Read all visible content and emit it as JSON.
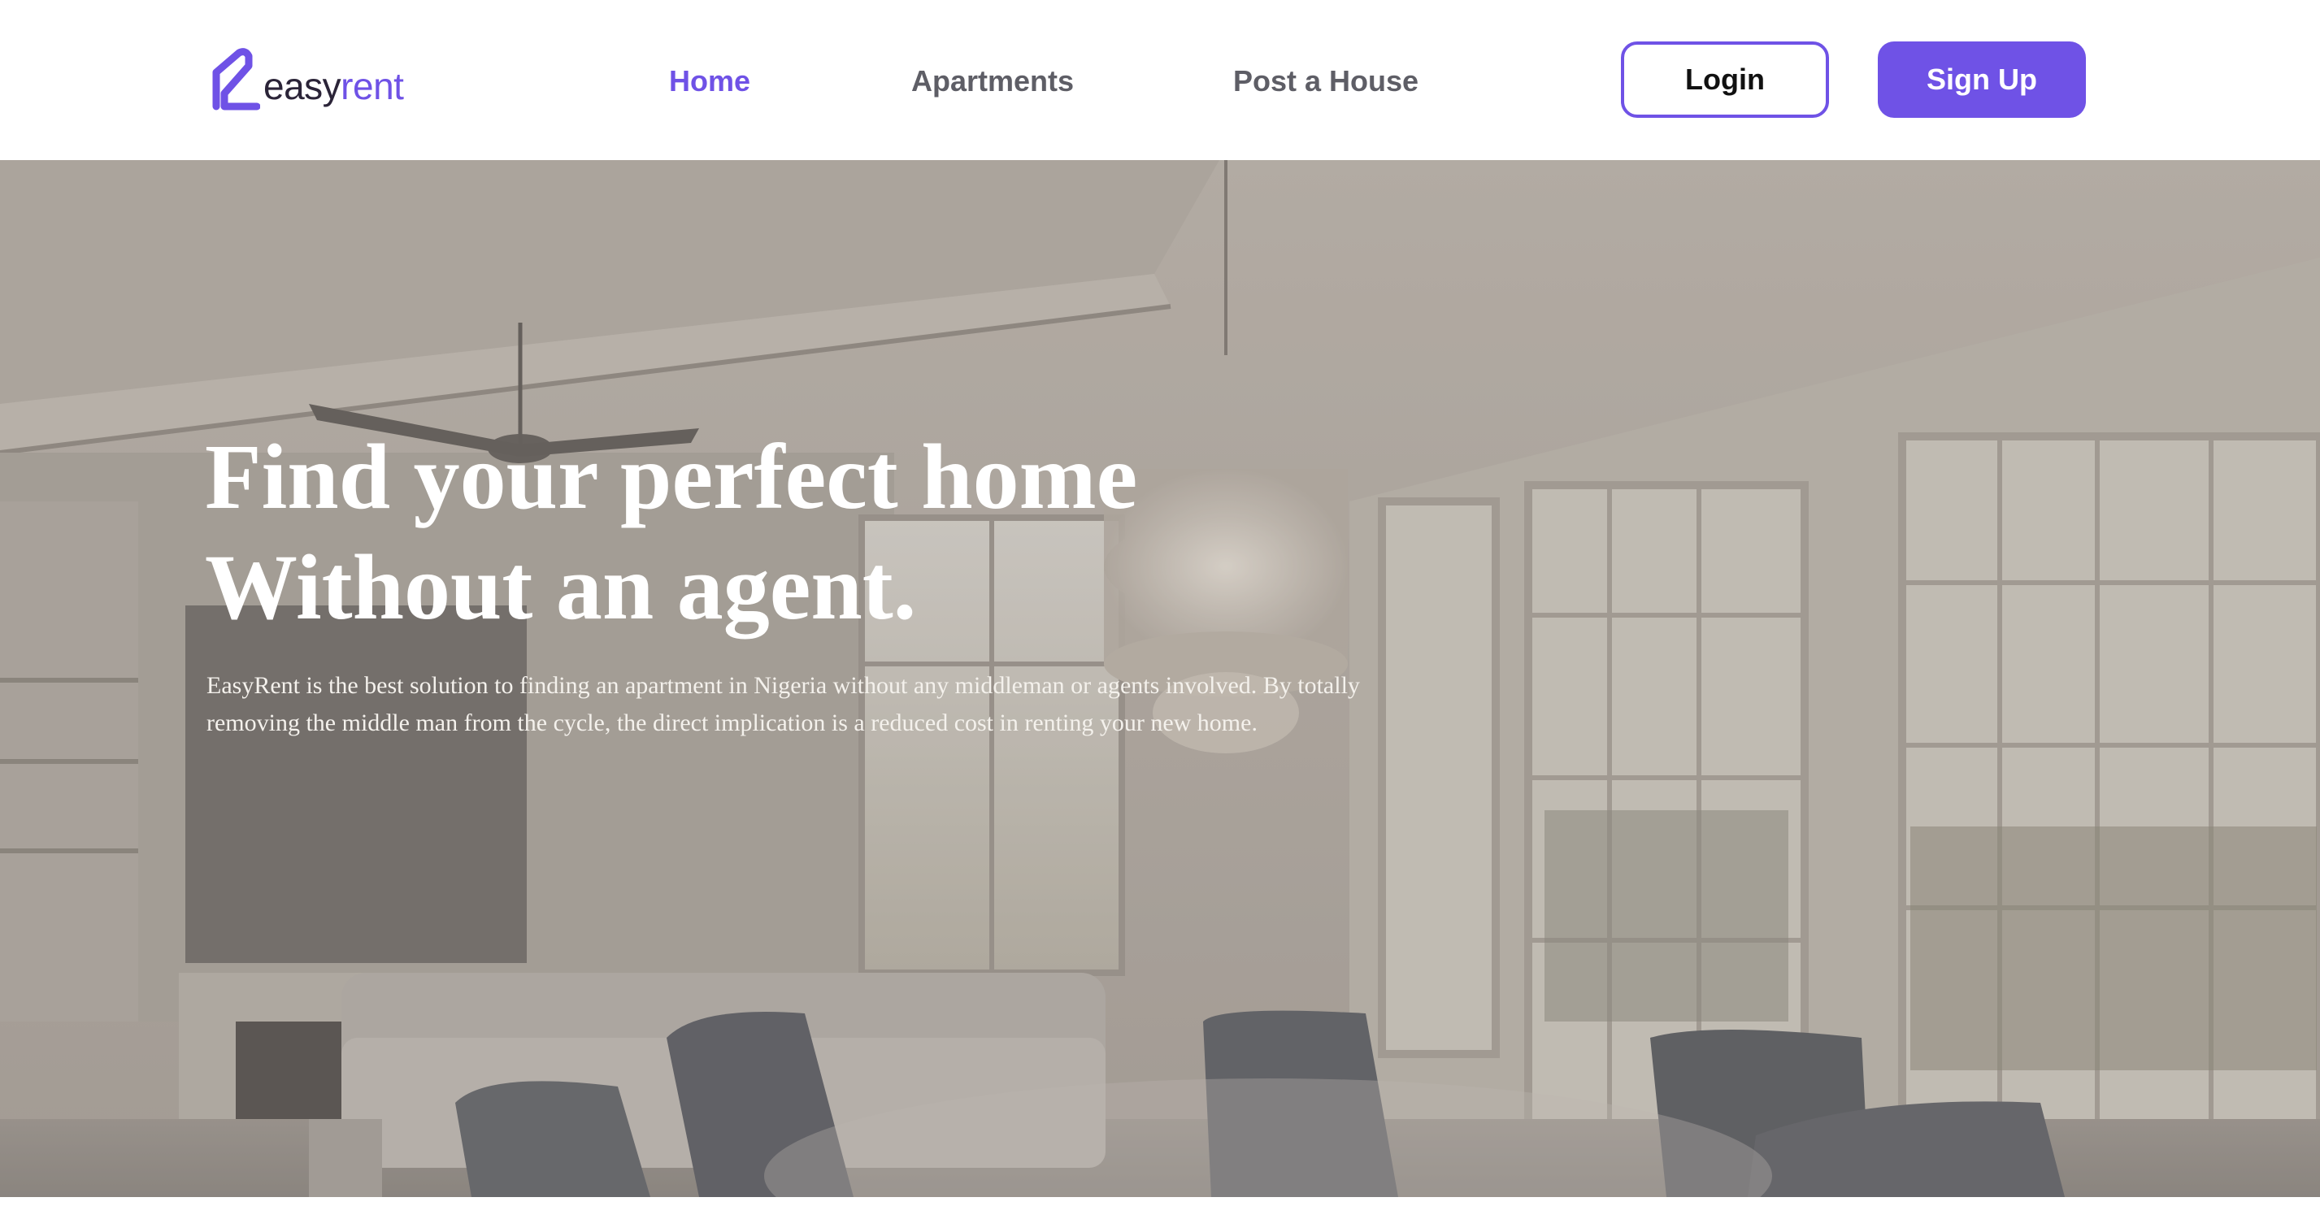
{
  "brand": {
    "part1": "easy",
    "part2": "rent",
    "accent_color": "#6f52e6",
    "dark_color": "#2b2438"
  },
  "nav": {
    "links": [
      {
        "label": "Home",
        "active": true
      },
      {
        "label": "Apartments",
        "active": false
      },
      {
        "label": "Post a House",
        "active": false
      }
    ],
    "login_label": "Login",
    "signup_label": "Sign Up"
  },
  "hero": {
    "title_line1": "Find your perfect home",
    "title_line2": "Without an agent.",
    "description": "EasyRent is the best solution to finding an apartment in Nigeria without any middleman or agents involved. By totally removing the middle man from the cycle, the direct implication is a reduced cost in renting your new home.",
    "background_image": "interior-living-dining-room-photo"
  }
}
